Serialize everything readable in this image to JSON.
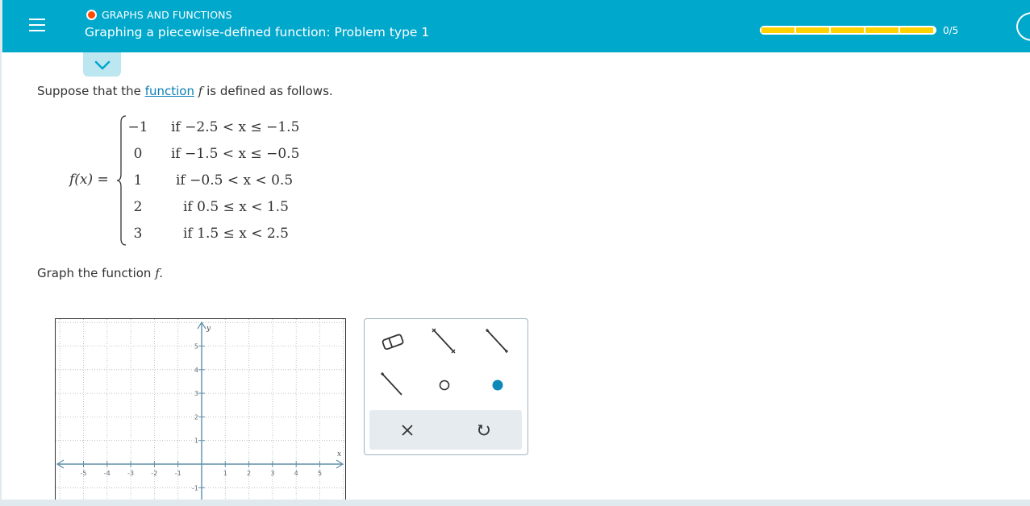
{
  "header": {
    "category": "GRAPHS AND FUNCTIONS",
    "title": "Graphing a piecewise-defined function: Problem type 1",
    "progress_text": "0/5",
    "progress_value": 0,
    "progress_segments": 5,
    "accent_color": "#00a8cc",
    "progress_color": "#ffd200",
    "status_dot_color": "#ff4a00"
  },
  "problem": {
    "intro_before": "Suppose that the ",
    "intro_link": "function",
    "intro_var": "f",
    "intro_after": " is defined as follows.",
    "function_label": "f(x) =",
    "pieces": [
      {
        "value": "−1",
        "condition": "if −2.5 < x ≤ −1.5"
      },
      {
        "value": "0",
        "condition": "if −1.5 < x ≤ −0.5"
      },
      {
        "value": "1",
        "condition": "if −0.5 < x < 0.5"
      },
      {
        "value": "2",
        "condition": "if 0.5 ≤ x < 1.5"
      },
      {
        "value": "3",
        "condition": "if 1.5 ≤ x < 2.5"
      }
    ],
    "instruction": "Graph the function",
    "instruction_var": "f."
  },
  "graph": {
    "x_axis_label": "x",
    "y_axis_label": "y",
    "x_ticks": [
      "-5",
      "-4",
      "-3",
      "-2",
      "-1",
      "1",
      "2",
      "3",
      "4",
      "5"
    ],
    "y_ticks": [
      "5",
      "4",
      "3",
      "2",
      "1",
      "-1"
    ]
  },
  "toolbox": {
    "tools": [
      "eraser-icon",
      "segment-open-open-icon",
      "segment-closed-closed-icon",
      "segment-closed-open-icon",
      "open-point-icon",
      "closed-point-icon"
    ],
    "actions": [
      "clear-icon",
      "undo-icon"
    ]
  }
}
